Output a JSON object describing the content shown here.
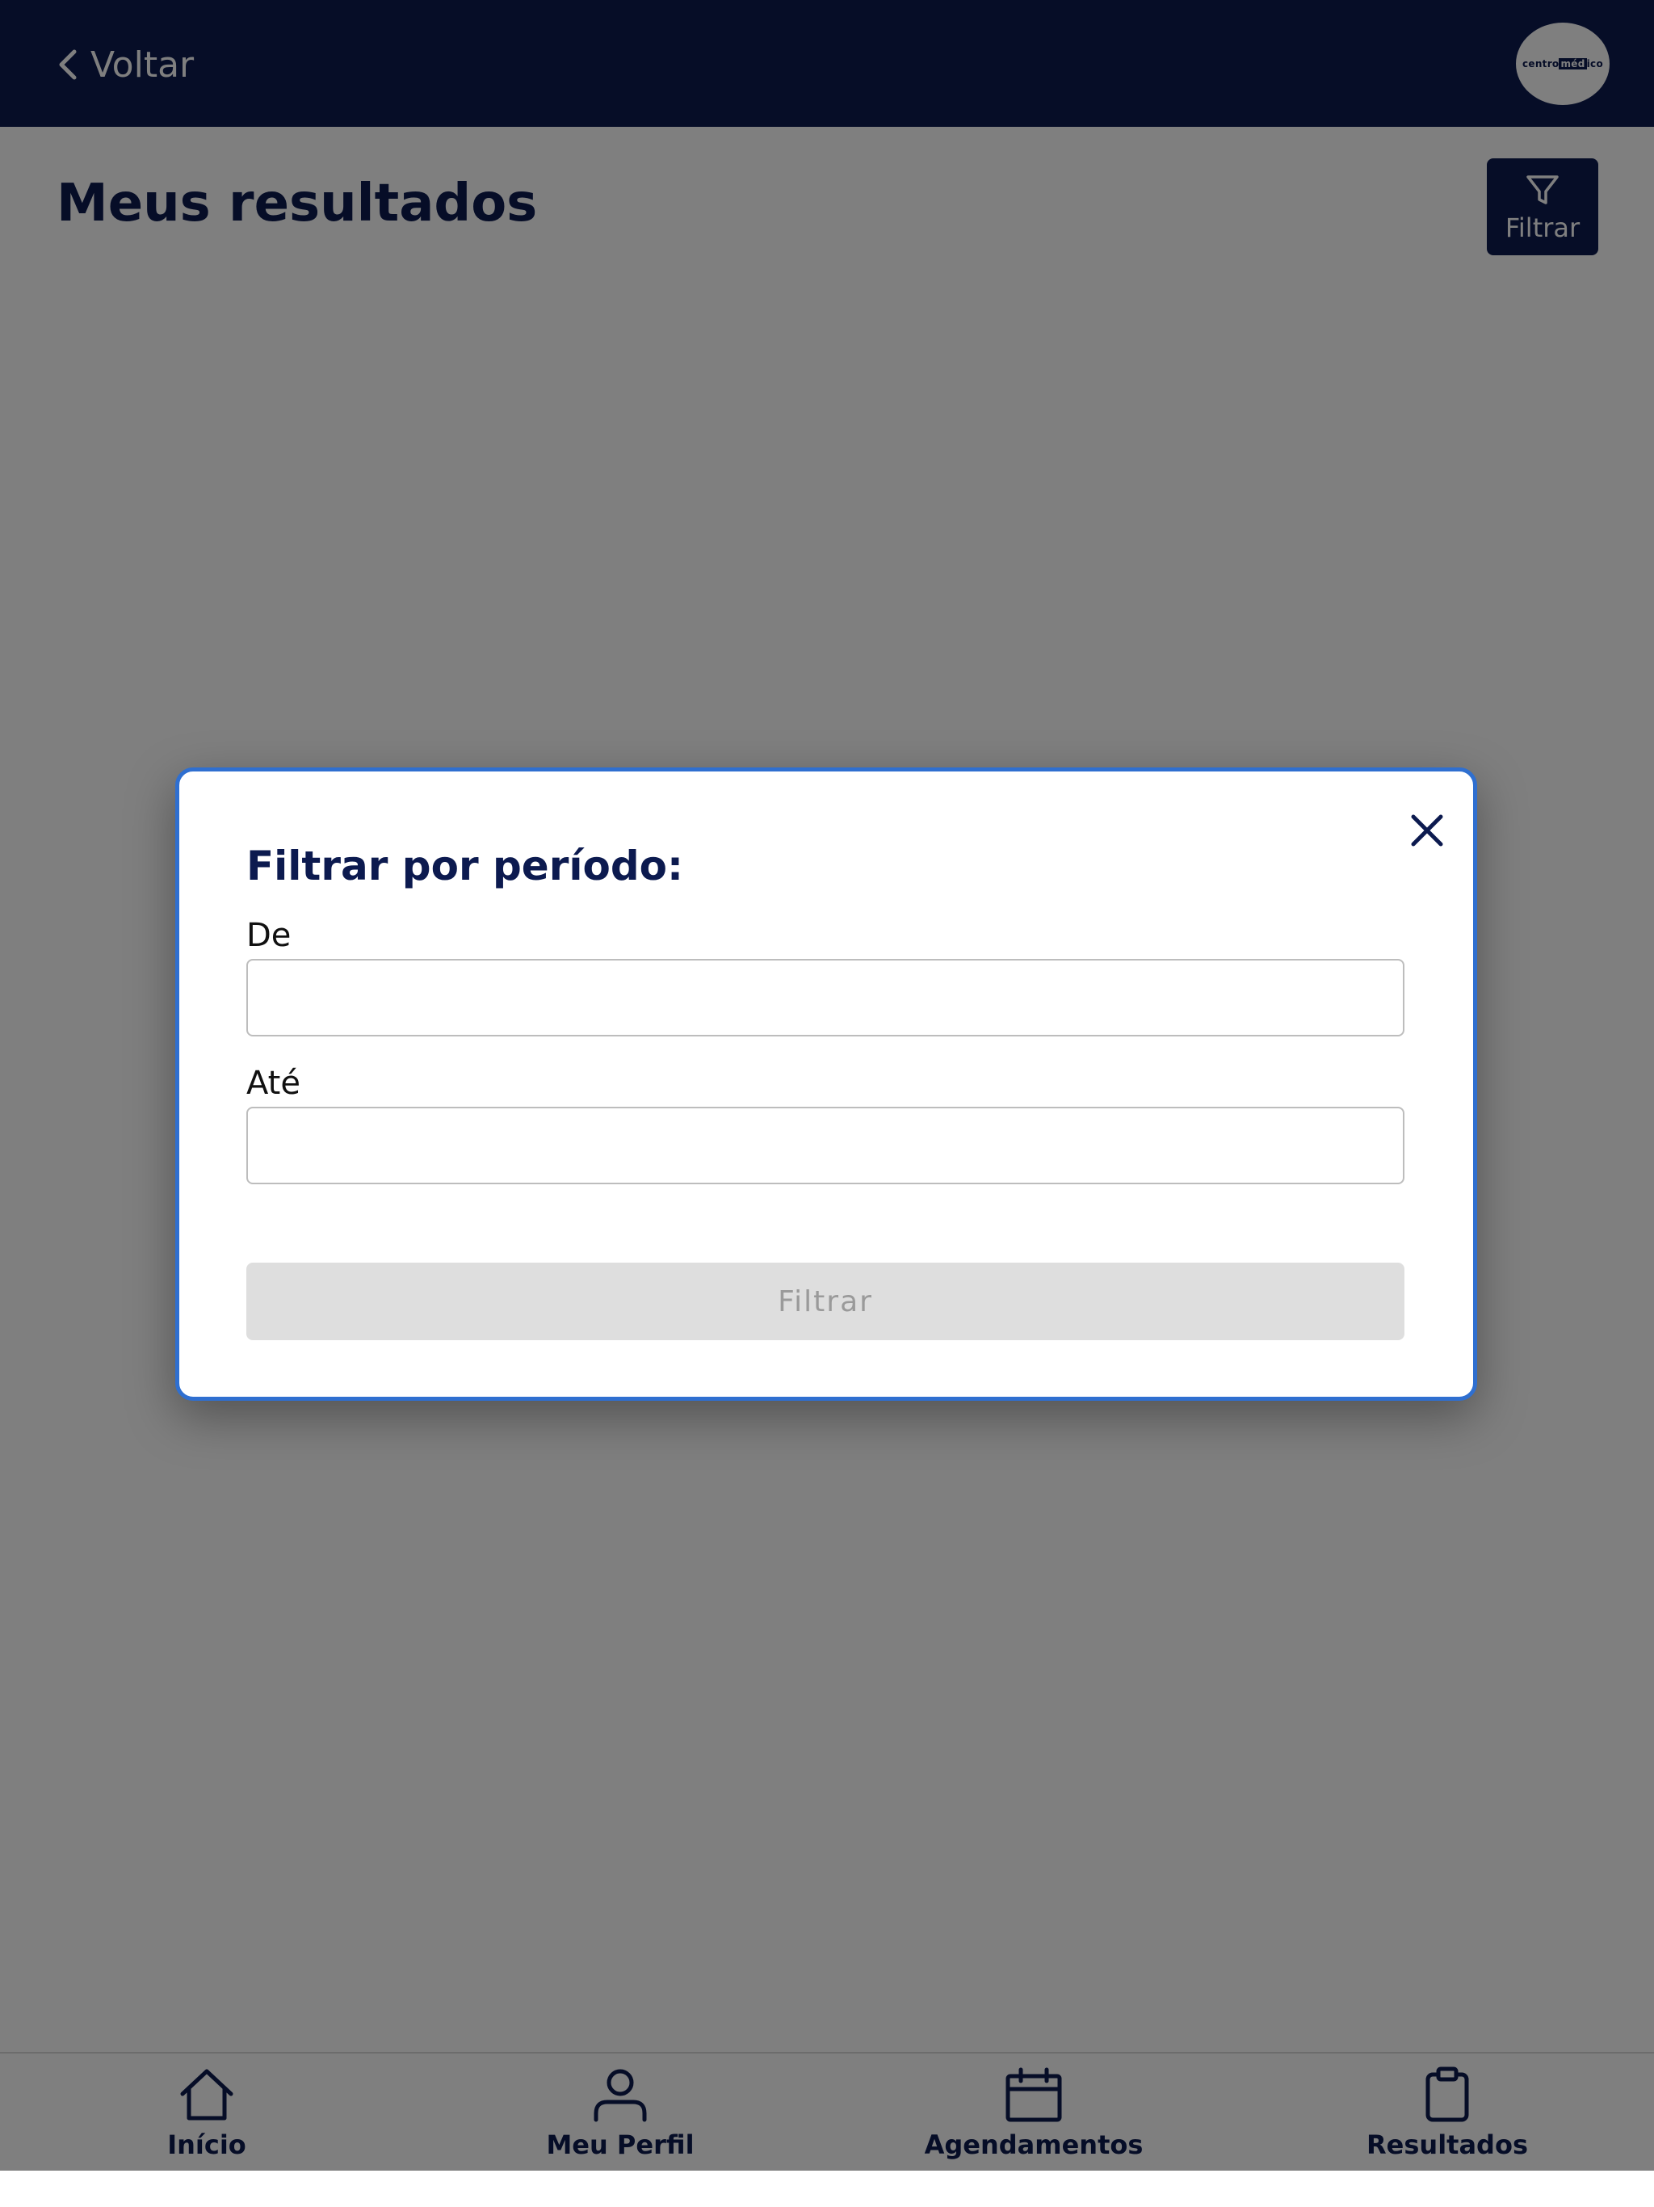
{
  "header": {
    "back_label": "Voltar",
    "logo_text_left": "centro",
    "logo_text_mid": "méd",
    "logo_text_right": "ico"
  },
  "main": {
    "title": "Meus resultados",
    "filter_button_label": "Filtrar"
  },
  "modal": {
    "title": "Filtrar por período:",
    "from_label": "De",
    "from_value": "",
    "to_label": "Até",
    "to_value": "",
    "submit_label": "Filtrar",
    "submit_enabled": false
  },
  "bottom_nav": {
    "items": [
      {
        "label": "Início",
        "icon": "home-icon"
      },
      {
        "label": "Meu Perfil",
        "icon": "user-icon"
      },
      {
        "label": "Agendamentos",
        "icon": "calendar-icon"
      },
      {
        "label": "Resultados",
        "icon": "clipboard-icon"
      }
    ]
  },
  "colors": {
    "primary": "#0c1a4f",
    "modal_border": "#2f6fd0",
    "overlay": "rgba(0,0,0,0.5)",
    "disabled_button_bg": "#dedede",
    "disabled_button_text": "#9a9a9a"
  }
}
